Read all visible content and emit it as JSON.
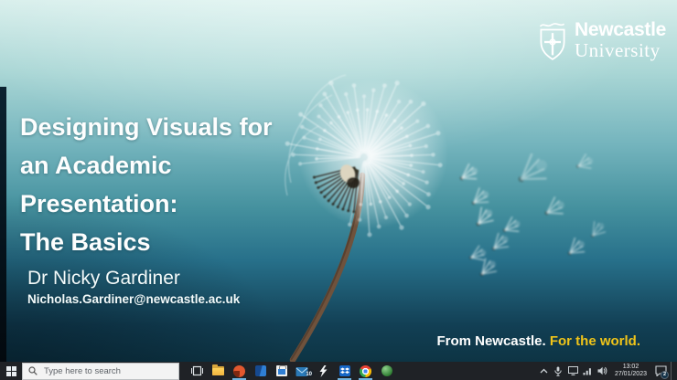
{
  "slide": {
    "logo": {
      "title": "Newcastle",
      "subtitle": "University"
    },
    "title_lines": [
      "Designing Visuals for",
      "an Academic",
      "Presentation:",
      "The Basics"
    ],
    "presenter": "Dr Nicky Gardiner",
    "email": "Nicholas.Gardiner@newcastle.ac.uk",
    "tagline": {
      "white": "From Newcastle.",
      "yellow": "For the world."
    },
    "colors": {
      "accent_yellow": "#f0c419",
      "bg_light": "#d7eeeb",
      "bg_dark": "#0d3444"
    }
  },
  "taskbar": {
    "search_placeholder": "Type here to search",
    "icons": [
      "start",
      "task-view",
      "file-explorer",
      "powerpoint",
      "word",
      "store",
      "mail",
      "lightning",
      "dropbox",
      "chrome",
      "green-orb"
    ],
    "mail_badge": "10",
    "tray": {
      "icons": [
        "chevron-up",
        "microphone",
        "display",
        "network",
        "volume"
      ],
      "time": "13:02",
      "date": "27/01/2023",
      "notification_badge": "2"
    }
  }
}
